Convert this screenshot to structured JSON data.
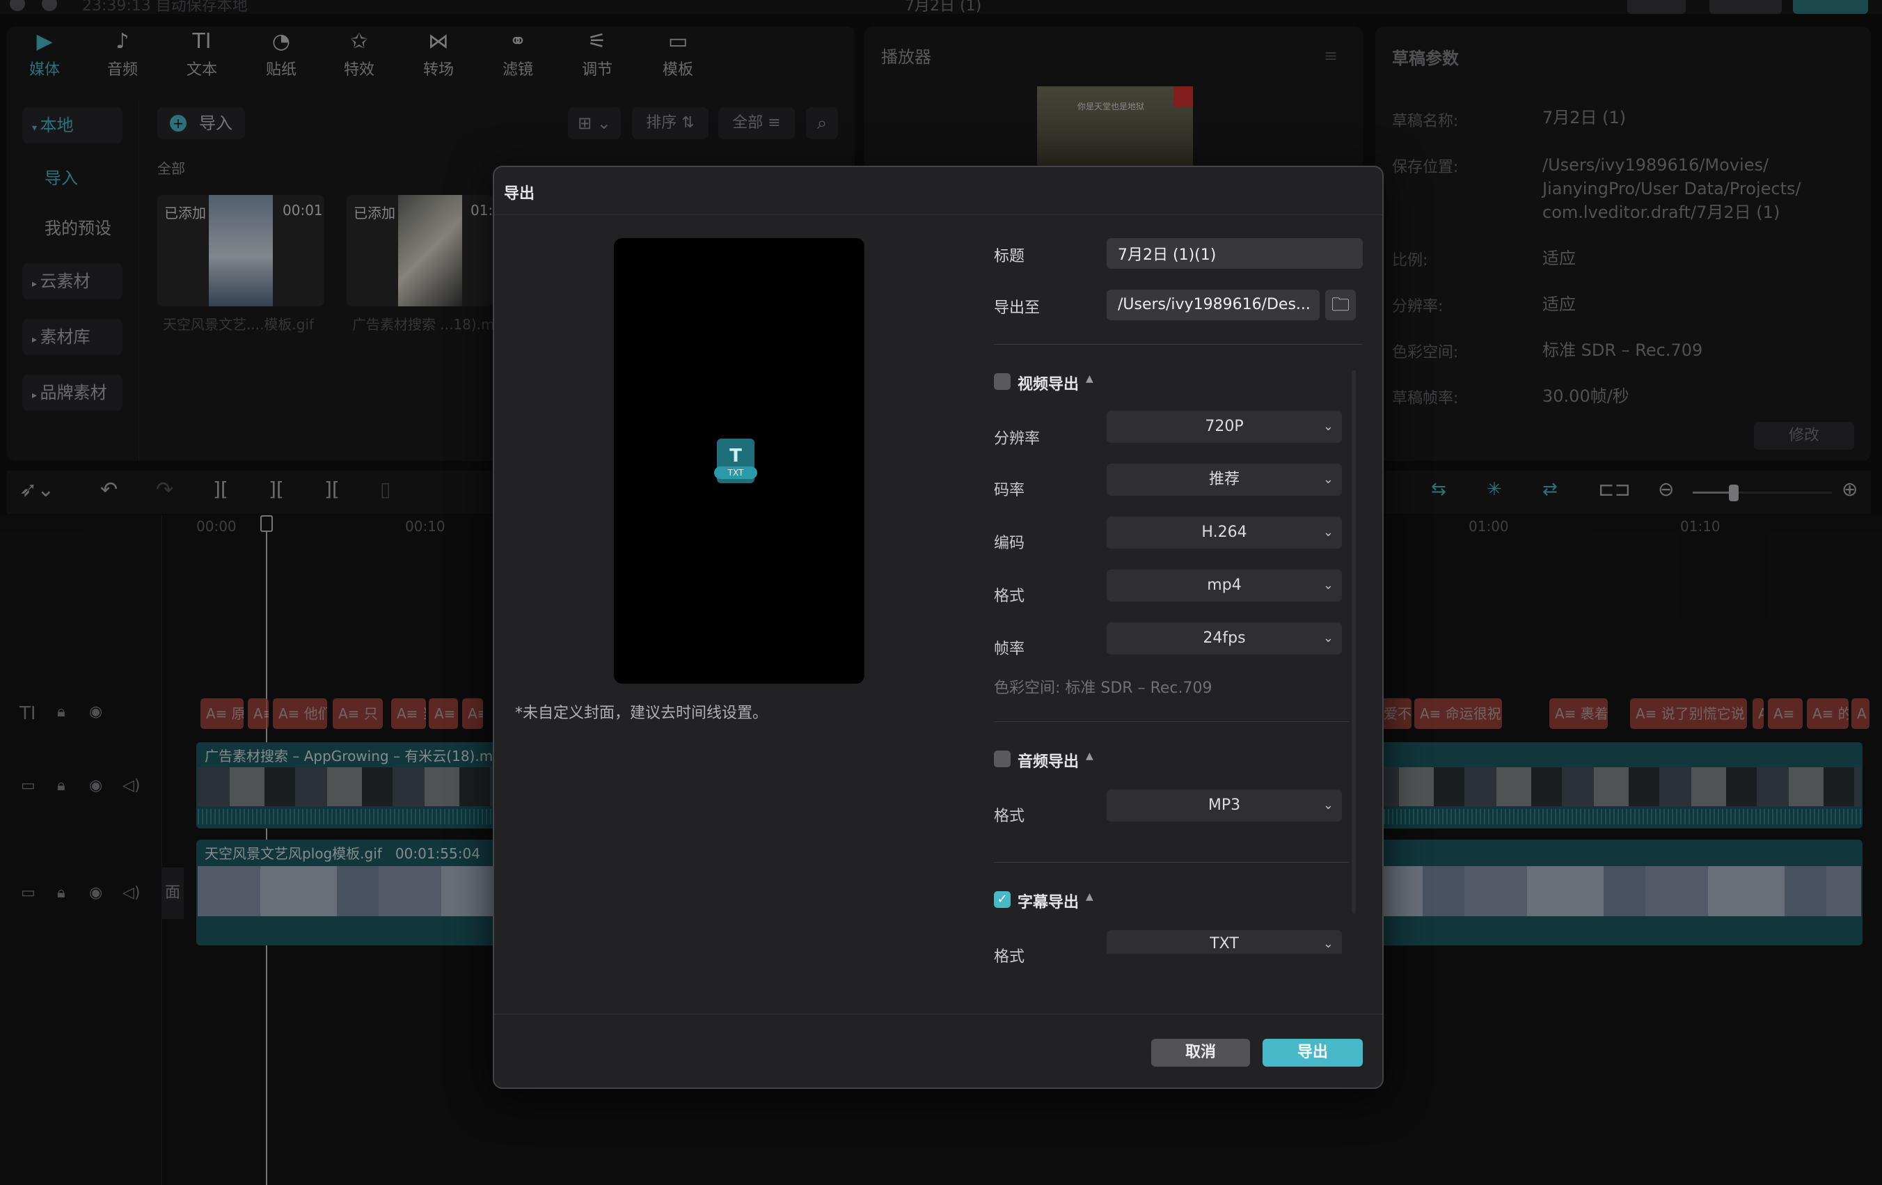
{
  "app": {
    "clock": "23:39:13 自动保存本地",
    "project_title": "7月2日 (1)"
  },
  "media_tabs": [
    {
      "label": "媒体",
      "icon": "media-icon",
      "glyph": "▶"
    },
    {
      "label": "音频",
      "icon": "audio-icon",
      "glyph": "♪"
    },
    {
      "label": "文本",
      "icon": "text-icon",
      "glyph": "TI"
    },
    {
      "label": "贴纸",
      "icon": "sticker-icon",
      "glyph": "◔"
    },
    {
      "label": "特效",
      "icon": "effects-icon",
      "glyph": "✩"
    },
    {
      "label": "转场",
      "icon": "transition-icon",
      "glyph": "⋈"
    },
    {
      "label": "滤镜",
      "icon": "filter-icon",
      "glyph": "⚭"
    },
    {
      "label": "调节",
      "icon": "adjust-icon",
      "glyph": "⚟"
    },
    {
      "label": "模板",
      "icon": "template-icon",
      "glyph": "▭"
    }
  ],
  "sidebar": {
    "local": "本地",
    "import": "导入",
    "my_presets": "我的预设",
    "cloud": "云素材",
    "library": "素材库",
    "brand": "品牌素材"
  },
  "media": {
    "import_button": "导入",
    "sort": "排序",
    "all_filter": "全部",
    "section": "全部",
    "items": [
      {
        "badge": "已添加",
        "duration": "00:01",
        "name": "天空风景文艺....模板.gif"
      },
      {
        "badge": "已添加",
        "duration": "01:",
        "name": "广告素材搜索 ...18).m"
      }
    ]
  },
  "player": {
    "title": "播放器",
    "overlay_text": "你是天堂也是地狱"
  },
  "draft_params": {
    "title": "草稿参数",
    "rows": [
      {
        "label": "草稿名称:",
        "value": "7月2日 (1)"
      },
      {
        "label": "保存位置:",
        "value": "/Users/ivy1989616/Movies/"
      },
      {
        "label": "",
        "value": "JianyingPro/User Data/Projects/"
      },
      {
        "label": "",
        "value": "com.lveditor.draft/7月2日 (1)"
      },
      {
        "label": "比例:",
        "value": "适应"
      },
      {
        "label": "分辨率:",
        "value": "适应"
      },
      {
        "label": "色彩空间:",
        "value": "标准 SDR – Rec.709"
      },
      {
        "label": "草稿帧率:",
        "value": "30.00帧/秒"
      }
    ],
    "modify_button": "修改"
  },
  "timeline": {
    "ticks": [
      "00:00",
      "00:10",
      "01:00",
      "01:10"
    ],
    "video_clip": "广告素材搜索 – AppGrowing – 有米云(18).mp",
    "gif_clip": "天空风景文艺风plog模板.gif",
    "gif_duration": "00:01:55:04",
    "cover_label": "面",
    "subtitle_chips_left": [
      "A≡ 原",
      "A≡",
      "A≡ 他们",
      "A≡ 只",
      "A≡ 当",
      "A≡",
      "A≡"
    ],
    "subtitle_chips_right": [
      "爱不",
      "A≡ 命运很祝",
      "A≡ 裹着",
      "A≡ 说了别慌它说",
      "A≡",
      "A≡",
      "A≡ 的",
      "A"
    ]
  },
  "export_dialog": {
    "title": "导出",
    "cover_hint": "*未自定义封面，建议去时间线设置。",
    "file_badge": "TXT",
    "title_label": "标题",
    "title_value": "7月2日 (1)(1)",
    "export_to_label": "导出至",
    "export_path": "/Users/ivy1989616/Des...",
    "video_section": "视频导出",
    "resolution_label": "分辨率",
    "resolution": "720P",
    "bitrate_label": "码率",
    "bitrate": "推荐",
    "codec_label": "编码",
    "codec": "H.264",
    "format_label": "格式",
    "format": "mp4",
    "fps_label": "帧率",
    "fps": "24fps",
    "colorspace": "色彩空间:  标准 SDR – Rec.709",
    "audio_section": "音频导出",
    "audio_format_label": "格式",
    "audio_format": "MP3",
    "subtitle_section": "字幕导出",
    "subtitle_format_label": "格式",
    "subtitle_format": "TXT",
    "video_checked": false,
    "audio_checked": false,
    "subtitle_checked": true,
    "cancel": "取消",
    "export": "导出"
  },
  "colors": {
    "accent": "#47b8c8",
    "subtitle_chip": "#c8544a"
  }
}
